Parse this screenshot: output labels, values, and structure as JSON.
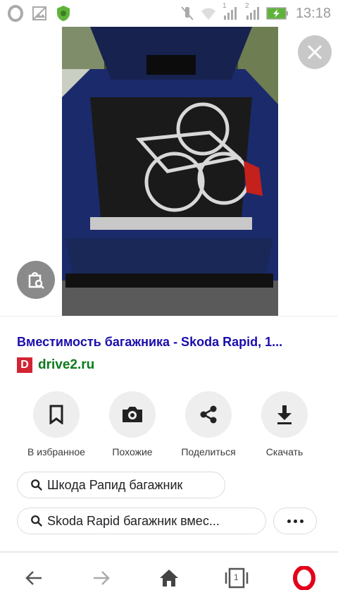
{
  "status_bar": {
    "time": "13:18",
    "sim1_label": "1",
    "sim2_label": "2",
    "icons": [
      "opera-icon",
      "image-icon",
      "shield-icon",
      "mute-icon",
      "wifi-icon",
      "signal-icon",
      "battery-charging-icon"
    ]
  },
  "image_viewer": {
    "photo_alt": "Вместимость багажника - Skoda Rapid",
    "close_icon": "close-icon",
    "lens_icon": "lens-search-icon"
  },
  "result": {
    "title": "Вместимость багажника - Skoda Rapid, 1...",
    "favicon_letter": "D",
    "source": "drive2.ru"
  },
  "actions": [
    {
      "label": "В избранное",
      "icon": "bookmark-icon"
    },
    {
      "label": "Похожие",
      "icon": "camera-icon"
    },
    {
      "label": "Поделиться",
      "icon": "share-icon"
    },
    {
      "label": "Скачать",
      "icon": "download-icon"
    }
  ],
  "related_searches": [
    {
      "text": "Шкода Рапид багажник"
    },
    {
      "text": "Skoda Rapid багажник вмес..."
    }
  ],
  "bottom_nav": {
    "tab_count": "1",
    "items": [
      "back-icon",
      "forward-icon",
      "home-icon",
      "tabs-icon",
      "opera-menu-icon"
    ]
  },
  "colors": {
    "title_link": "#1a0dab",
    "source_green": "#0b7a1c",
    "favicon_red": "#d32433",
    "opera_red": "#e3001b",
    "car_blue": "#1b2a6b"
  }
}
